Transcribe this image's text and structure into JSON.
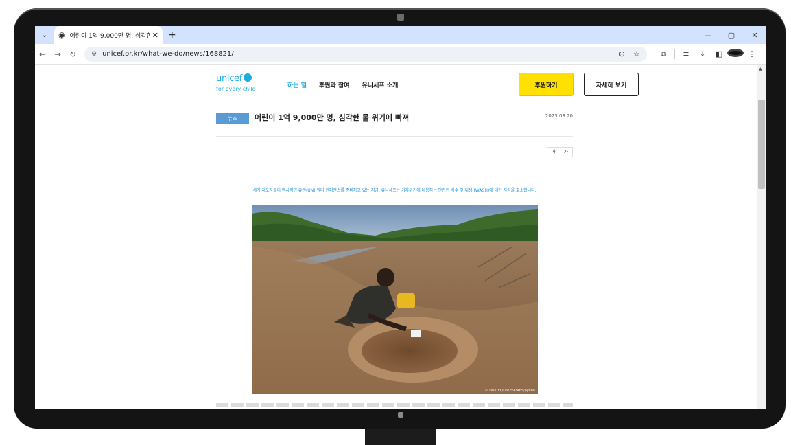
{
  "browser": {
    "tab_title": "어린이 1억 9,000만 명, 심각한",
    "url": "unicef.or.kr/what-we-do/news/168821/",
    "new_tab_label": "+",
    "close_label": "✕"
  },
  "site": {
    "logo_text": "unicef",
    "logo_tagline": "for every child",
    "nav": [
      "하는 일",
      "후원과 참여",
      "유니세프 소개"
    ],
    "donate_label": "후원하기",
    "more_label": "자세히 보기"
  },
  "article": {
    "badge": "뉴스",
    "headline": "어린이 1억 9,000만 명, 심각한 물 위기에 빠져",
    "date": "2023.03.20",
    "font_small": "가",
    "font_large": "가",
    "lead": "세계 지도자들이 역사적인 유엔(UN) 워터 컨퍼런스를 준비하고 있는 지금, 유니세프는 기후위기에 대응하는 안전한 식수 및 위생 (WASH)에 대한 지원을 호소합니다.",
    "photo_credit": "© UNICEF/UN0597465/Ayene"
  },
  "colors": {
    "brand": "#1cabe2",
    "donate": "#ffe000",
    "badge": "#5b9bd5",
    "tabstrip": "#d3e3fd"
  }
}
